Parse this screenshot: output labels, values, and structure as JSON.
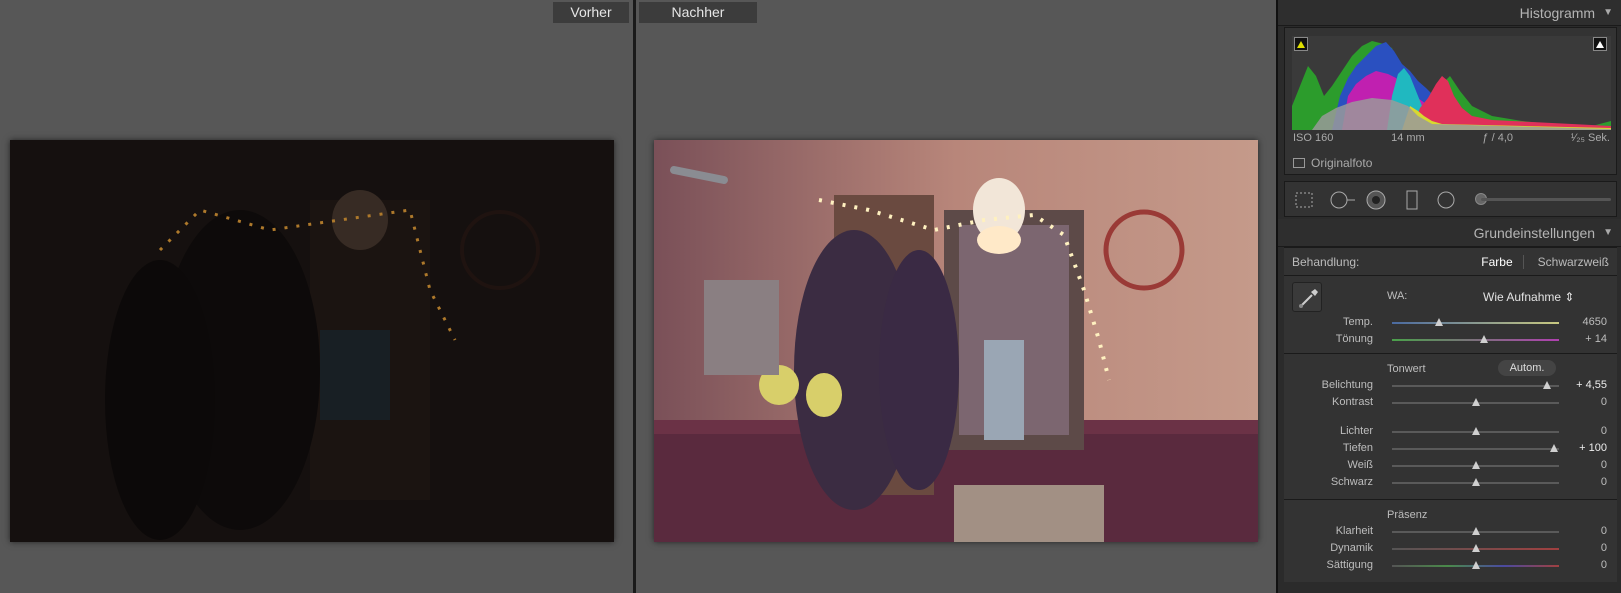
{
  "compare": {
    "before_label": "Vorher",
    "after_label": "Nachher"
  },
  "panel": {
    "histogram": {
      "title": "Histogramm",
      "iso": "ISO 160",
      "focal": "14 mm",
      "aperture": "ƒ / 4,0",
      "shutter": "¹⁄₂₅ Sek.",
      "original_label": "Originalfoto"
    },
    "basic": {
      "title": "Grundeinstellungen",
      "treatment_label": "Behandlung:",
      "treatment_color": "Farbe",
      "treatment_bw": "Schwarzweiß",
      "wb_label": "WA:",
      "wb_value": "Wie Aufnahme ⇕",
      "temp": {
        "label": "Temp.",
        "value": "4650",
        "pos": 0.28
      },
      "tint": {
        "label": "Tönung",
        "value": "+ 14",
        "pos": 0.55
      },
      "tone_title": "Tonwert",
      "auto_label": "Autom.",
      "exposure": {
        "label": "Belichtung",
        "value": "+ 4,55",
        "pos": 0.93
      },
      "contrast": {
        "label": "Kontrast",
        "value": "0",
        "pos": 0.5
      },
      "highlights": {
        "label": "Lichter",
        "value": "0",
        "pos": 0.5
      },
      "shadows": {
        "label": "Tiefen",
        "value": "+ 100",
        "pos": 0.97
      },
      "whites": {
        "label": "Weiß",
        "value": "0",
        "pos": 0.5
      },
      "blacks": {
        "label": "Schwarz",
        "value": "0",
        "pos": 0.5
      },
      "presence_title": "Präsenz",
      "clarity": {
        "label": "Klarheit",
        "value": "0",
        "pos": 0.5
      },
      "vibrance": {
        "label": "Dynamik",
        "value": "0",
        "pos": 0.5
      },
      "saturation": {
        "label": "Sättigung",
        "value": "0",
        "pos": 0.5
      }
    }
  }
}
